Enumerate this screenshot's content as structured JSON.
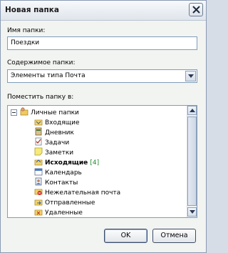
{
  "window": {
    "title": "Новая папка",
    "close_icon": "close-icon"
  },
  "name_field": {
    "label": "Имя папки:",
    "value": "Поездки"
  },
  "content_field": {
    "label": "Содержимое папки:",
    "value": "Элементы типа Почта"
  },
  "place_field": {
    "label": "Поместить папку в:"
  },
  "tree": {
    "root": {
      "label": "Личные папки",
      "icon": "personal-folders-icon"
    },
    "items": [
      {
        "label": "Входящие",
        "icon": "inbox-icon",
        "badge": ""
      },
      {
        "label": "Дневник",
        "icon": "journal-icon",
        "badge": ""
      },
      {
        "label": "Задачи",
        "icon": "tasks-icon",
        "badge": ""
      },
      {
        "label": "Заметки",
        "icon": "notes-icon",
        "badge": ""
      },
      {
        "label": "Исходящие",
        "icon": "outbox-icon",
        "badge": "[4]",
        "selected": true
      },
      {
        "label": "Календарь",
        "icon": "calendar-icon",
        "badge": ""
      },
      {
        "label": "Контакты",
        "icon": "contacts-icon",
        "badge": ""
      },
      {
        "label": "Нежелательная почта",
        "icon": "junk-mail-icon",
        "badge": ""
      },
      {
        "label": "Отправленные",
        "icon": "sent-items-icon",
        "badge": ""
      },
      {
        "label": "Удаленные",
        "icon": "deleted-items-icon",
        "badge": ""
      }
    ]
  },
  "buttons": {
    "ok": "OK",
    "cancel": "Отмена"
  }
}
